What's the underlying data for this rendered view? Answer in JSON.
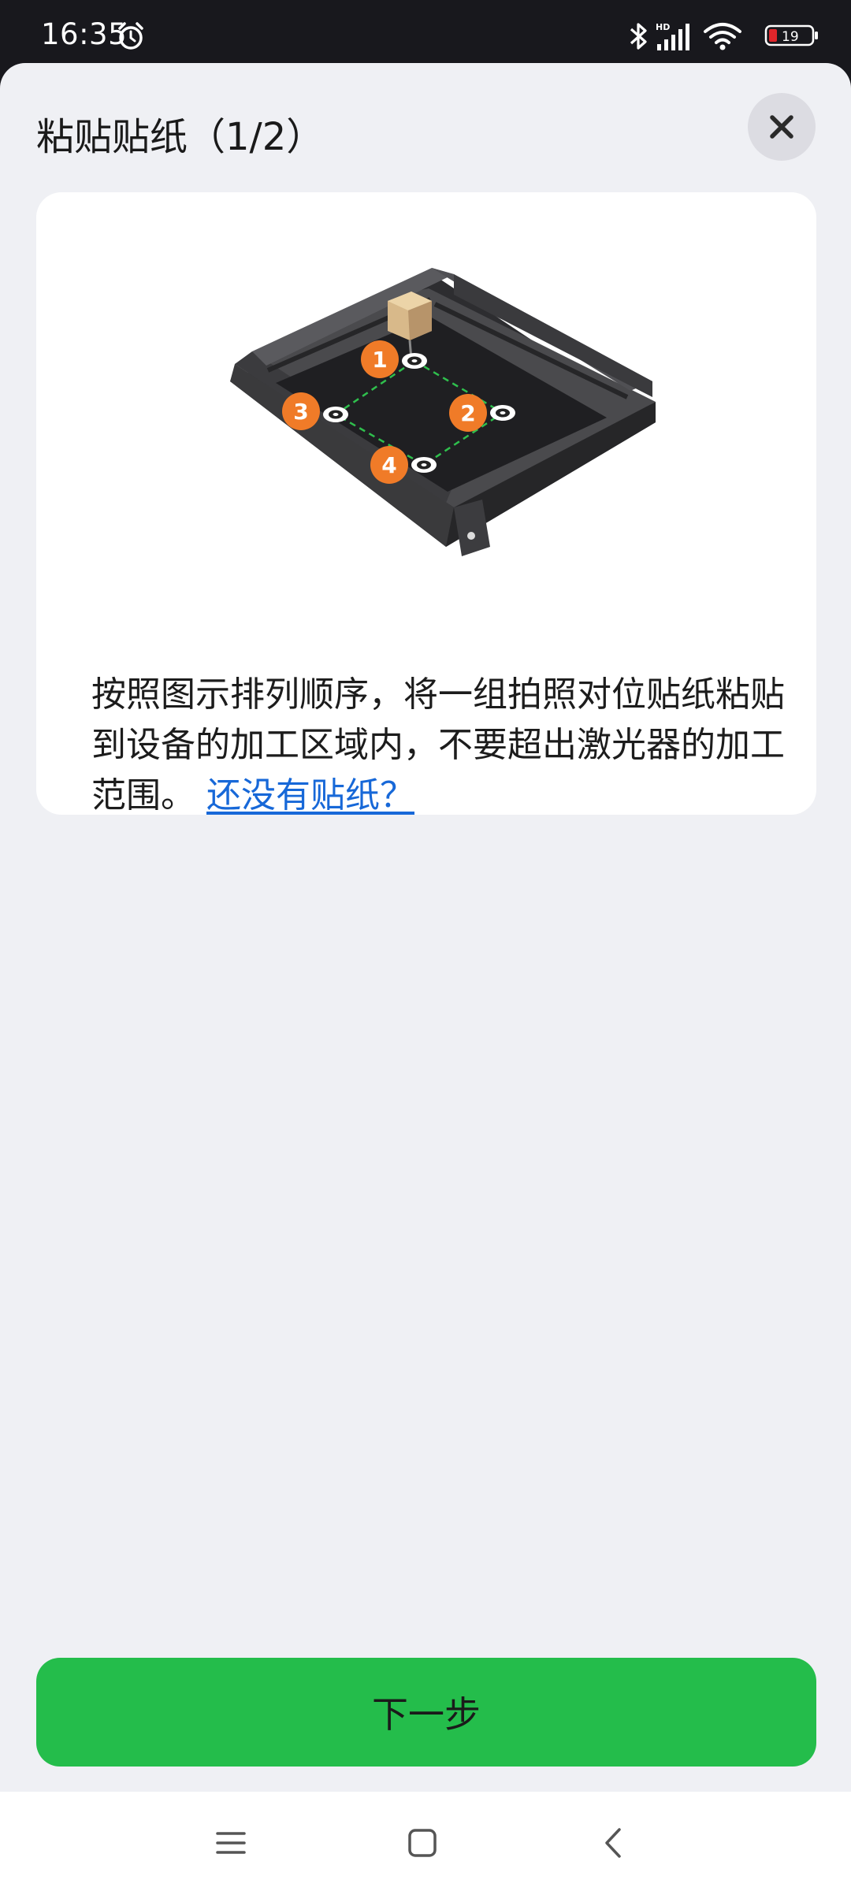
{
  "status_bar": {
    "time": "16:35",
    "network_label": "HD",
    "battery_level": "19"
  },
  "dialog": {
    "title": "粘贴贴纸（1/2）",
    "close_icon": "close-icon",
    "markers": [
      "1",
      "2",
      "3",
      "4"
    ],
    "instruction_text": "按照图示排列顺序，将一组拍照对位贴纸粘贴到设备的加工区域内，不要超出激光器的加工范围。",
    "help_link": "还没有贴纸？",
    "next_button": "下一步"
  },
  "nav_bar": {
    "icons": [
      "menu-icon",
      "home-square-icon",
      "back-chevron-icon"
    ]
  },
  "colors": {
    "accent_green": "#24bd4b",
    "link_blue": "#1768d8",
    "marker_orange": "#f07b28",
    "background": "#eff0f4"
  }
}
